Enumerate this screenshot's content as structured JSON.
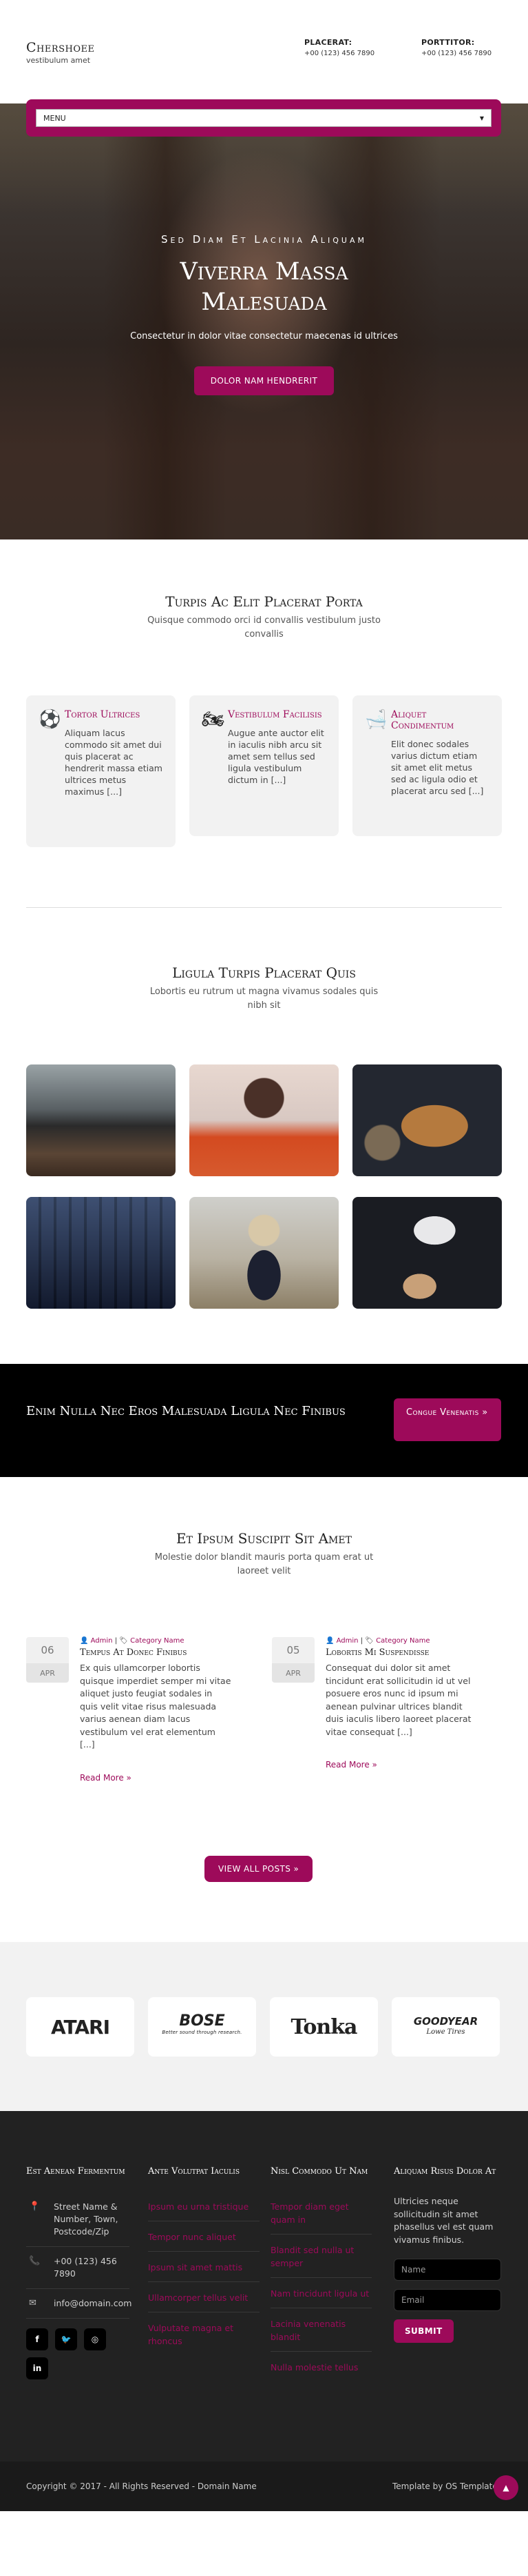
{
  "brand": {
    "name": "Chershoee",
    "tagline": "vestibulum amet"
  },
  "contact": [
    {
      "label": "PLACERAT:",
      "value": "+00 (123) 456 7890"
    },
    {
      "label": "PORTTITOR:",
      "value": "+00 (123) 456 7890"
    }
  ],
  "nav": {
    "menu_label": "MENU"
  },
  "hero": {
    "kicker": "Sed Diam Et Lacinia Aliquam",
    "title_line1": "Viverra Massa",
    "title_line2": "Malesuada",
    "subtitle": "Consectetur in dolor vitae consectetur maecenas id ultrices",
    "button": "DOLOR NAM HENDRERIT"
  },
  "services": {
    "title": "Turpis Ac Elit Placerat Porta",
    "subtitle": "Quisque commodo orci id convallis vestibulum justo convallis",
    "items": [
      {
        "icon": "soccer-ball-icon",
        "title": "Tortor Ultrices",
        "text": "Aliquam lacus commodo sit amet dui quis placerat ac hendrerit massa etiam ultrices metus maximus [...]"
      },
      {
        "icon": "motorbike-icon",
        "title": "Vestibulum Facilisis",
        "text": "Augue ante auctor elit in iaculis nibh arcu sit amet sem tellus sed ligula vestibulum dictum in [...]"
      },
      {
        "icon": "bathtub-icon",
        "title": "Aliquet Condimentum",
        "text": "Elit donec sodales varius dictum etiam sit amet elit metus sed ac ligula odio et placerat arcu sed [...]"
      }
    ]
  },
  "gallery": {
    "title": "Ligula Turpis Placerat Quis",
    "subtitle": "Lobortis eu rutrum ut magna vivamus sodales quis nibh sit"
  },
  "cta": {
    "title": "Enim Nulla Nec Eros Malesuada Ligula Nec Finibus",
    "button": "Congue Venenatis »"
  },
  "blog": {
    "title": "Et Ipsum Suscipit Sit Amet",
    "subtitle": "Molestie dolor blandit mauris porta quam erat ut laoreet velit",
    "posts": [
      {
        "day": "06",
        "month": "APR",
        "author": "Admin",
        "category": "Category Name",
        "title": "Tempus At Donec Finibus",
        "text": "Ex quis ullamcorper lobortis quisque imperdiet semper mi vitae aliquet justo feugiat sodales in quis velit vitae risus malesuada varius aenean diam lacus vestibulum vel erat elementum [...]",
        "more": "Read More »"
      },
      {
        "day": "05",
        "month": "APR",
        "author": "Admin",
        "category": "Category Name",
        "title": "Lobortis Mi Suspendisse",
        "text": "Consequat dui dolor sit amet tincidunt erat sollicitudin id ut vel posuere eros nunc id ipsum mi aenean pulvinar ultrices blandit duis iaculis libero laoreet placerat vitae consequat [...]",
        "more": "Read More »"
      }
    ],
    "view_all": "VIEW ALL POSTS »"
  },
  "brands": [
    {
      "name": "ATARI"
    },
    {
      "name": "BOSE",
      "tagline": "Better sound through research."
    },
    {
      "name": "Tonka"
    },
    {
      "name": "GOODYEAR",
      "tagline": "Lowe Tires"
    }
  ],
  "footer": {
    "col1": {
      "title": "Est Aenean Fermentum",
      "address": "Street Name & Number, Town, Postcode/Zip",
      "phone": "+00 (123) 456 7890",
      "email": "info@domain.com",
      "social": [
        "facebook-icon",
        "twitter-icon",
        "dribbble-icon",
        "linkedin-icon"
      ]
    },
    "col2": {
      "title": "Ante Volutpat Iaculis",
      "links": [
        "Ipsum eu urna tristique",
        "Tempor nunc aliquet",
        "Ipsum sit amet mattis",
        "Ullamcorper tellus velit",
        "Vulputate magna et rhoncus"
      ]
    },
    "col3": {
      "title": "Nisl Commodo Ut Nam",
      "links": [
        "Tempor diam eget quam in",
        "Blandit sed nulla ut semper",
        "Nam tincidunt ligula ut",
        "Lacinia venenatis blandit",
        "Nulla molestie tellus"
      ]
    },
    "col4": {
      "title": "Aliquam Risus Dolor At",
      "text": "Ultricies neque sollicitudin sit amet phasellus vel est quam vivamus finibus.",
      "name_placeholder": "Name",
      "email_placeholder": "Email",
      "submit": "SUBMIT"
    },
    "copyright": "Copyright © 2017 - All Rights Reserved - Domain Name",
    "credit": "Template by OS Templates"
  },
  "colors": {
    "accent": "#9d0a5a",
    "dark": "#222222",
    "black": "#000000"
  }
}
